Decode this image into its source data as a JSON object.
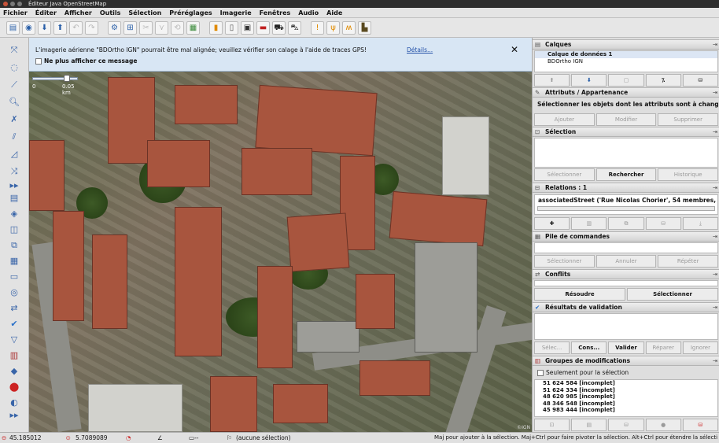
{
  "window": {
    "title": "Éditeur Java OpenStreetMap"
  },
  "menu": [
    "Fichier",
    "Éditer",
    "Afficher",
    "Outils",
    "Sélection",
    "Préréglages",
    "Imagerie",
    "Fenêtres",
    "Audio",
    "Aide"
  ],
  "notice": {
    "message": "L'imagerie aérienne \"BDOrtho IGN\" pourrait être mal alignée; veuillez vérifier son calage à l'aide de traces GPS!",
    "checkbox_label": "Ne plus afficher ce message",
    "details_link": "Détails...",
    "close": "✕"
  },
  "map": {
    "scale_zero": "0",
    "scale_label": "0.05 km",
    "attribution": "©IGN"
  },
  "panels": {
    "layers": {
      "title": "Calques",
      "items": [
        "Calque de données 1",
        "BDOrtho IGN"
      ]
    },
    "attributes": {
      "title": "Attributs / Appartenance",
      "hint": "Sélectionner les objets dont les attributs sont à changer.",
      "buttons": [
        "Ajouter",
        "Modifier",
        "Supprimer"
      ]
    },
    "selection": {
      "title": "Sélection",
      "buttons": [
        "Sélectionner",
        "Rechercher",
        "Historique"
      ]
    },
    "relations": {
      "title": "Relations : 1",
      "item": "associatedStreet ('Rue Nicolas Chorier', 54 membres, inc"
    },
    "commands": {
      "title": "Pile de commandes",
      "buttons": [
        "Sélectionner",
        "Annuler",
        "Répéter"
      ]
    },
    "conflicts": {
      "title": "Conflits",
      "buttons": [
        "Résoudre",
        "Sélectionner"
      ]
    },
    "validation": {
      "title": "Résultats de validation",
      "buttons": [
        "Sélec...",
        "Cons...",
        "Valider",
        "Réparer",
        "Ignorer"
      ]
    },
    "changesets": {
      "title": "Groupes de modifications",
      "filter_label": "Seulement pour la sélection",
      "items": [
        "51 624 584 [incomplet]",
        "51 624 334 [incomplet]",
        "48 620 985 [incomplet]",
        "48 346 548 [incomplet]",
        "45 983 444 [incomplet]"
      ]
    }
  },
  "status": {
    "lat": "45.185012",
    "lon": "5.7089089",
    "heading_icon": "compass-icon",
    "selection": "(aucune sélection)",
    "hint": "Maj pour ajouter à la sélection. Maj+Ctrl pour faire pivoter la sélection. Alt+Ctrl pour étendre la sélection"
  },
  "colors": {
    "accent": "#2a5fa8",
    "notice_bg": "#d8e6f4",
    "roof": "#a8553e"
  }
}
